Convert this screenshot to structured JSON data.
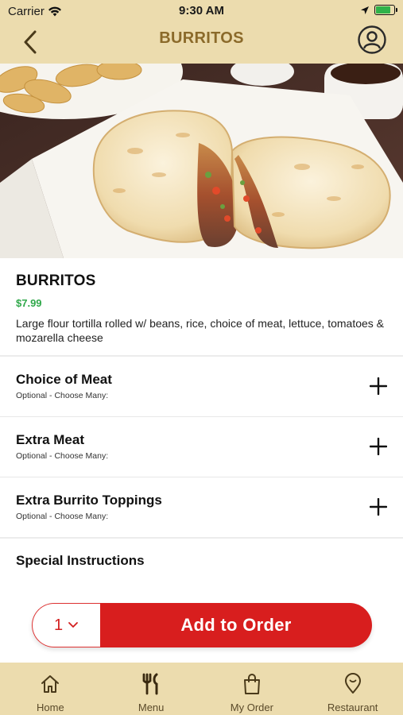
{
  "status_bar": {
    "carrier": "Carrier",
    "time": "9:30 AM",
    "battery_level": 0.8
  },
  "nav": {
    "title": "BURRITOS",
    "back_icon": "chevron-left-icon",
    "profile_icon": "user-circle-icon"
  },
  "item": {
    "name": "BURRITOS",
    "price": "$7.99",
    "description": "Large flour tortilla rolled w/ beans, rice, choice of meat, lettuce, tomatoes & mozarella cheese"
  },
  "options": [
    {
      "title": "Choice of Meat",
      "subtitle": "Optional - Choose Many:"
    },
    {
      "title": "Extra Meat",
      "subtitle": "Optional - Choose Many:"
    },
    {
      "title": "Extra Burrito Toppings",
      "subtitle": "Optional - Choose Many:"
    }
  ],
  "special_instructions": {
    "label": "Special Instructions"
  },
  "order": {
    "quantity": "1",
    "add_label": "Add to Order"
  },
  "tabs": [
    {
      "label": "Home",
      "icon": "home-icon"
    },
    {
      "label": "Menu",
      "icon": "fork-knife-icon"
    },
    {
      "label": "My Order",
      "icon": "shopping-bag-icon"
    },
    {
      "label": "Restaurant",
      "icon": "location-pin-icon"
    }
  ],
  "colors": {
    "header_bg": "#ecdcae",
    "title_brown": "#8b6a2a",
    "price_green": "#2fa84a",
    "accent_red": "#d81e1e"
  }
}
